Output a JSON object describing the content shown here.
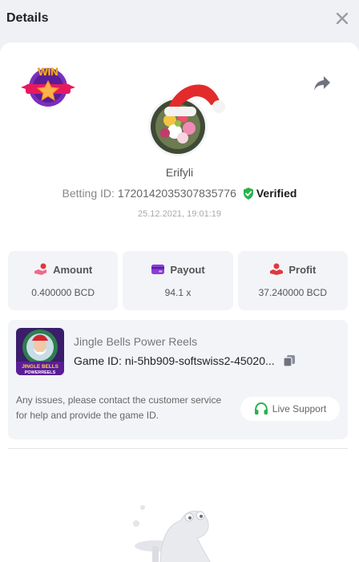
{
  "header": {
    "title": "Details"
  },
  "user": {
    "name": "Erifyli"
  },
  "bet": {
    "id_label": "Betting ID:",
    "id_value": "1720142035307835776",
    "verified_label": "Verified",
    "timestamp": "25.12.2021, 19:01:19"
  },
  "badge": {
    "text": "WIN"
  },
  "stats": [
    {
      "label": "Amount",
      "value": "0.400000 BCD",
      "icon": "hand-coin-icon"
    },
    {
      "label": "Payout",
      "value": "94.1 x",
      "icon": "wallet-card-icon"
    },
    {
      "label": "Profit",
      "value": "37.240000 BCD",
      "icon": "profit-hand-icon"
    }
  ],
  "game": {
    "name": "Jingle Bells Power Reels",
    "id_label": "Game ID:",
    "id_value": "ni-5hb909-softswiss2-45020...",
    "thumb_line1": "JINGLE BELLS",
    "thumb_line2": "POWERREELS"
  },
  "support": {
    "message": "Any issues, please contact the customer service for help and provide the game ID.",
    "button_label": "Live Support"
  },
  "colors": {
    "accent_green": "#2bb24c",
    "badge_purple": "#7b2fbe",
    "badge_pink": "#e6195f",
    "profit_red": "#e0383e",
    "payout_purple": "#8a3ed6"
  }
}
